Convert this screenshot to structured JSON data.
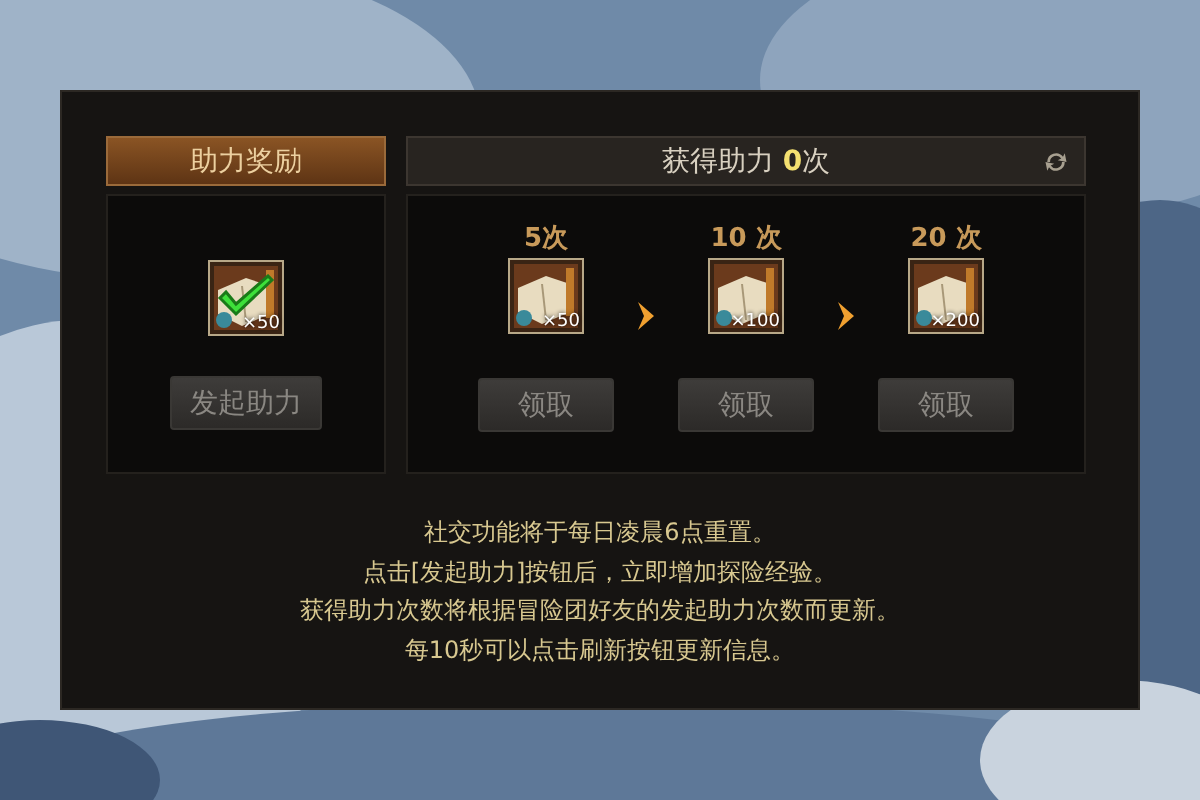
{
  "left_panel": {
    "header": "助力奖励",
    "reward": {
      "quantity": "×50",
      "checked": true
    },
    "button": {
      "label": "发起助力",
      "disabled": true
    }
  },
  "right_panel": {
    "header": "获得助力 **0**次",
    "rewards": [
      {
        "threshold": "5次",
        "quantity": "×50",
        "button": {
          "label": "领取",
          "disabled": true
        }
      },
      {
        "threshold": "10 次",
        "quantity": "×100",
        "button": {
          "label": "领取",
          "disabled": true
        }
      },
      {
        "threshold": "20 次",
        "quantity": "×200",
        "button": {
          "label": "领取",
          "disabled": true
        }
      }
    ]
  },
  "notes": [
    "社交功能将于每日凌晨6点重置。",
    "点击[发起助力]按钮后，立即增加探险经验。",
    "获得助力次数将根据冒险团好友的发起助力次数而更新。",
    "每10秒可以点击刷新按钮更新信息。"
  ]
}
